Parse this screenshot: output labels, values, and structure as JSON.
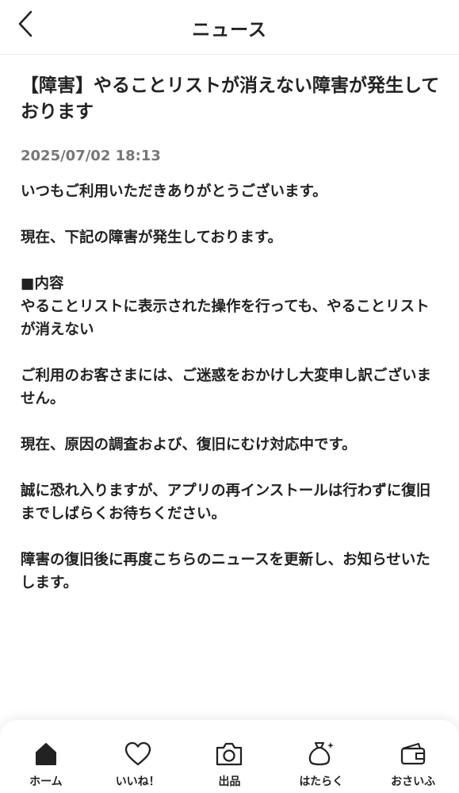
{
  "header": {
    "back_icon": "chevron-left-icon",
    "title": "ニュース"
  },
  "article": {
    "title": "【障害】やることリストが消えない障害が発生しております",
    "date": "2025/07/02 18:13",
    "paragraphs": [
      "いつもご利用いただきありがとうございます。",
      "現在、下記の障害が発生しております。",
      "■内容\nやることリストに表示された操作を行っても、やることリストが消えない",
      "ご利用のお客さまには、ご迷惑をおかけし大変申し訳ございません。",
      "現在、原因の調査および、復旧にむけ対応中です。",
      "誠に恐れ入りますが、アプリの再インストールは行わずに復旧までしばらくお待ちください。",
      "障害の復旧後に再度こちらのニュースを更新し、お知らせいたします。"
    ]
  },
  "bottom_nav": {
    "items": [
      {
        "label": "ホーム",
        "icon": "home-icon"
      },
      {
        "label": "いいね！",
        "icon": "heart-icon"
      },
      {
        "label": "出品",
        "icon": "camera-icon"
      },
      {
        "label": "はたらく",
        "icon": "money-bag-icon"
      },
      {
        "label": "おさいふ",
        "icon": "wallet-icon"
      }
    ]
  },
  "colors": {
    "text": "#222222",
    "date": "#777777",
    "divider": "#ececec"
  }
}
